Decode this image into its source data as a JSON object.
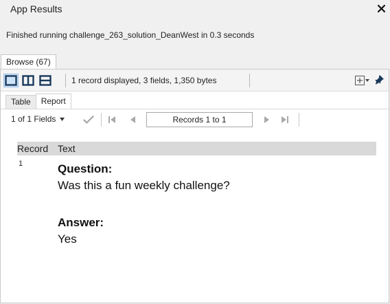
{
  "window": {
    "title": "App Results",
    "close_glyph": "×"
  },
  "status_message": "Finished running challenge_263_solution_DeanWest in 0.3 seconds",
  "browse_tab": {
    "label": "Browse (67)"
  },
  "toolbar": {
    "record_info": "1 record displayed, 3 fields, 1,350 bytes",
    "view_buttons": [
      "single-pane-icon",
      "split-vertical-icon",
      "split-horizontal-icon"
    ],
    "right_icons": [
      "table-options-icon",
      "pin-icon"
    ]
  },
  "subtabs": {
    "table": "Table",
    "report": "Report"
  },
  "navbar": {
    "fields_select": "1 of 1 Fields",
    "records_range": "Records 1 to 1"
  },
  "report": {
    "columns": {
      "record": "Record",
      "text": "Text"
    },
    "rows": [
      {
        "record": "1",
        "question_label": "Question:",
        "question_text": "Was this a fun weekly challenge?",
        "answer_label": "Answer:",
        "answer_text": "Yes"
      }
    ]
  },
  "colors": {
    "active_view_bg": "#cde3f7",
    "header_bg": "#d9d9d9",
    "accent": "#1f5fa6"
  }
}
